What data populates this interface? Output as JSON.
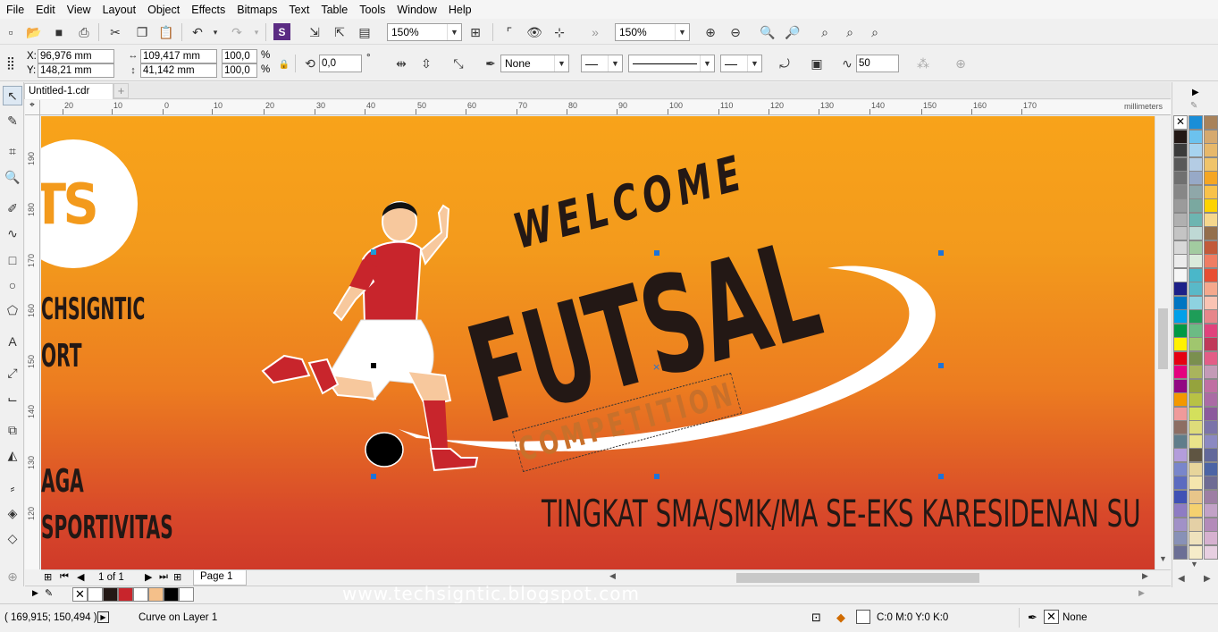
{
  "menu": [
    "File",
    "Edit",
    "View",
    "Layout",
    "Object",
    "Effects",
    "Bitmaps",
    "Text",
    "Table",
    "Tools",
    "Window",
    "Help"
  ],
  "toolbar": {
    "zoom_left": "150%",
    "zoom_right": "150%"
  },
  "properties": {
    "x_label": "X:",
    "x_value": "96,976 mm",
    "y_label": "Y:",
    "y_value": "148,21 mm",
    "width_value": "109,417 mm",
    "height_value": "41,142 mm",
    "scale_x": "100,0",
    "scale_y": "100,0",
    "percent_sign": "%",
    "rotation_value": "0,0",
    "degree_sign": "°",
    "fill_none": "None",
    "smoothing_value": "50"
  },
  "document": {
    "tab_title": "Untitled-1.cdr",
    "ruler_unit": "millimeters",
    "page_count": "1 of 1",
    "page_tab": "Page 1"
  },
  "hruler_ticks": [
    "20",
    "10",
    "0",
    "10",
    "20",
    "30",
    "40",
    "50",
    "60",
    "70",
    "80",
    "90",
    "100",
    "110",
    "120",
    "130",
    "140",
    "150",
    "160",
    "170"
  ],
  "vruler_ticks": [
    "190",
    "180",
    "170",
    "160",
    "150",
    "140",
    "130",
    "120"
  ],
  "artwork": {
    "logo_text": "TS",
    "left_line1": "CHSIGNTIC",
    "left_line2": "ORT",
    "left_line3": "AGA",
    "left_line4": "SPORTIVITAS",
    "welcome": "WELCOME",
    "futsal": "FUTSAL",
    "competition": "COMPETITION",
    "tagline": "TINGKAT SMA/SMK/MA SE-EKS KARESIDENAN SU",
    "watermark": "www.techsigntic.blogspot.com"
  },
  "status": {
    "coords": "( 169,915; 150,494 )",
    "object_info": "Curve on Layer 1",
    "fill_info": "C:0 M:0 Y:0 K:0",
    "outline_info": "None"
  },
  "colors": {
    "bg_top": "#f8a31a",
    "bg_bottom": "#cf3a29",
    "text_dark": "#231815",
    "competition": "#c9702a",
    "jersey_red": "#c8252c",
    "selection_handle": "#1e73d8"
  },
  "palette_colors": [
    [
      "#ffffff",
      "#1a8ed8",
      "#a8825a"
    ],
    [
      "#231815",
      "#6cc2ee",
      "#d6a96e"
    ],
    [
      "#3b3b3b",
      "#a7d3ef",
      "#e7b86a"
    ],
    [
      "#595959",
      "#b4cce4",
      "#f0c46a"
    ],
    [
      "#707070",
      "#97a9c7",
      "#f5a623"
    ],
    [
      "#878787",
      "#8fa7a9",
      "#f8c24a"
    ],
    [
      "#9b9b9b",
      "#7aa8a0",
      "#fed300"
    ],
    [
      "#b0b0b0",
      "#6db5b1",
      "#f5d78d"
    ],
    [
      "#c4c4c4",
      "#bfd9d5",
      "#946f4c"
    ],
    [
      "#d8d8d8",
      "#a2cba0",
      "#c25a3a"
    ],
    [
      "#ececec",
      "#daeadb",
      "#ef7d63"
    ],
    [
      "#f6f6f6",
      "#4ab7c9",
      "#e84e33"
    ],
    [
      "#1d2088",
      "#59b9c8",
      "#f5a88d"
    ],
    [
      "#0075c2",
      "#8ed2e0",
      "#fac3b3"
    ],
    [
      "#00a0e9",
      "#1e9d58",
      "#e7868a"
    ],
    [
      "#009944",
      "#6cbb84",
      "#e0427c"
    ],
    [
      "#fff100",
      "#a0c66e",
      "#c0395a"
    ],
    [
      "#e60012",
      "#7a8f4f",
      "#e35d87"
    ],
    [
      "#e4007f",
      "#a9b45d",
      "#c49ab7"
    ],
    [
      "#920783",
      "#95a33d",
      "#c06fa3"
    ],
    [
      "#f39800",
      "#b8c245",
      "#ab6ba5"
    ],
    [
      "#ef9a9a",
      "#d4e05c",
      "#8c5a9d"
    ],
    [
      "#8d6e63",
      "#dedc7a",
      "#7b73a9"
    ],
    [
      "#607d8b",
      "#e9e38a",
      "#8b89c2"
    ],
    [
      "#b39ddb",
      "#5f5542",
      "#62689a"
    ],
    [
      "#7986cb",
      "#e7d59b",
      "#4c64a5"
    ],
    [
      "#5c6bc0",
      "#f5e6ad",
      "#6e6b94"
    ],
    [
      "#3f51b5",
      "#e8c58a",
      "#9d7ea4"
    ],
    [
      "#8e7cc3",
      "#f5d16f",
      "#c2a2c7"
    ],
    [
      "#a191c7",
      "#e4d0a6",
      "#b38bb9"
    ],
    [
      "#8891b7",
      "#efe2bd",
      "#d6b1d0"
    ],
    [
      "#6c6f95",
      "#f6ecc9",
      "#e7cfe1"
    ]
  ],
  "doc_palette": [
    "#ffffff",
    "#231815",
    "#c8252c",
    "#ffffff",
    "#f5c08a",
    "#000000",
    "#ffffff"
  ]
}
